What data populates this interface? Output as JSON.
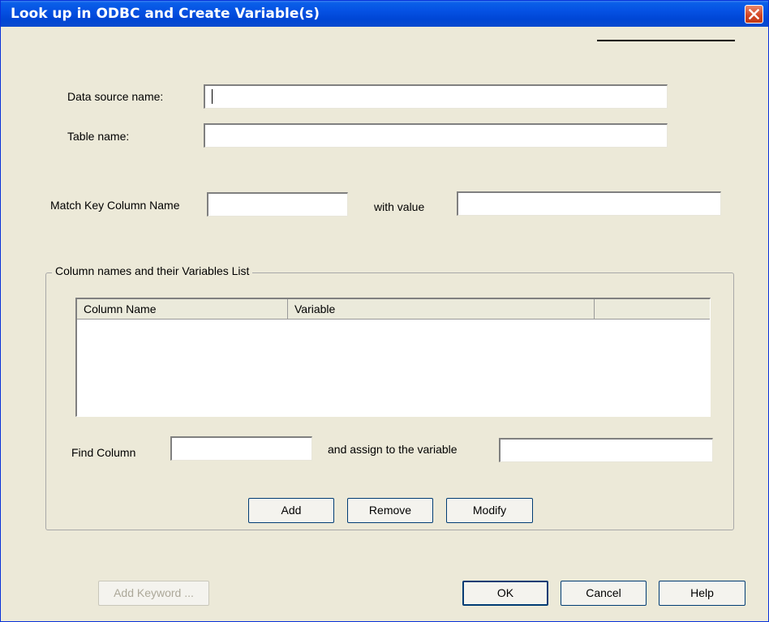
{
  "window": {
    "title": "Look up in ODBC and Create Variable(s)"
  },
  "connection": {
    "data_source_label": "Data source name:",
    "data_source_value": "",
    "table_label": "Table name:",
    "table_value": ""
  },
  "match": {
    "key_label": "Match Key Column Name",
    "key_value": "",
    "with_value_label": "with value",
    "with_value": ""
  },
  "columns_group": {
    "title": "Column names and their Variables List",
    "headers": [
      "Column Name",
      "Variable",
      ""
    ],
    "rows": [],
    "find_column_label": "Find Column",
    "find_column_value": "",
    "assign_label": "and assign to the variable",
    "assign_value": "",
    "buttons": {
      "add": "Add",
      "remove": "Remove",
      "modify": "Modify"
    }
  },
  "footer": {
    "add_keyword": "Add Keyword ...",
    "ok": "OK",
    "cancel": "Cancel",
    "help": "Help"
  },
  "colors": {
    "titlebar": "#0551E3",
    "dialog_bg": "#ECE9D8",
    "close_button": "#D24322"
  }
}
